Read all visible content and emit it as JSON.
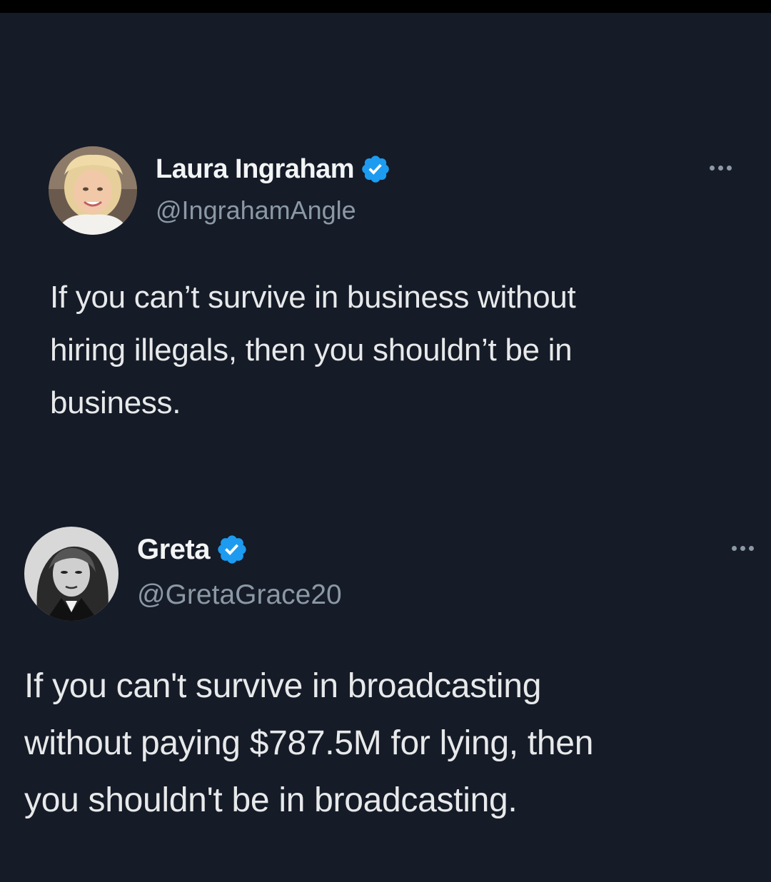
{
  "tweets": [
    {
      "display_name": "Laura Ingraham",
      "handle": "@IngrahamAngle",
      "verified": true,
      "avatar_icon": "profile-photo-woman-blonde",
      "text": "If you can’t survive in business without\nhiring illegals, then you shouldn’t be in\nbusiness."
    },
    {
      "display_name": "Greta",
      "handle": "@GretaGrace20",
      "verified": true,
      "avatar_icon": "profile-photo-black-and-white-portrait",
      "text": "If you can't survive in broadcasting\nwithout paying $787.5M for lying, then\nyou shouldn't be in broadcasting."
    }
  ],
  "colors": {
    "background": "#151b27",
    "text": "#e7e9ea",
    "secondary_text": "#8b98a5",
    "verified_badge": "#1d9bf0"
  },
  "icons": {
    "verified": "verified-badge-icon",
    "more": "more-options-icon"
  }
}
